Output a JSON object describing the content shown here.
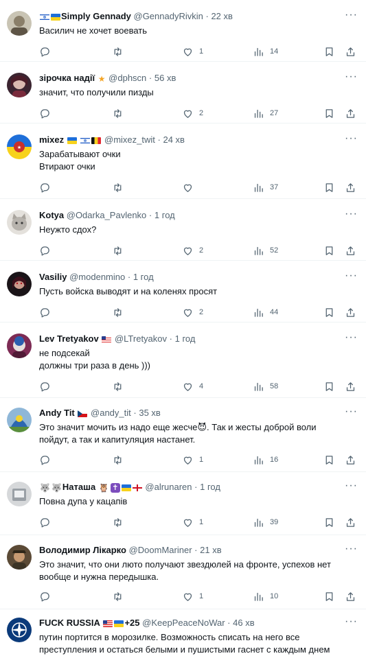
{
  "posts": [
    {
      "prefix": "",
      "name": "Simply Gennady",
      "handle": "@GennadyRivkin",
      "time": "22 хв",
      "lines": [
        "Василич не хочет воевать"
      ],
      "reply": "",
      "retweet": "",
      "like": "1",
      "views": "14"
    },
    {
      "prefix": "",
      "name": "зірочка надії",
      "handle": "@dphscn",
      "time": "56 хв",
      "lines": [
        "значит, что получили пизды"
      ],
      "reply": "",
      "retweet": "",
      "like": "2",
      "views": "27"
    },
    {
      "prefix": "",
      "name": "mixez",
      "handle": "@mixez_twit",
      "time": "24 хв",
      "lines": [
        "Зарабатывают очки",
        "Втирают очки"
      ],
      "reply": "",
      "retweet": "",
      "like": "",
      "views": "37"
    },
    {
      "prefix": "",
      "name": "Kotya",
      "handle": "@Odarka_Pavlenko",
      "time": "1 год",
      "lines": [
        "Неужто сдох?"
      ],
      "reply": "",
      "retweet": "",
      "like": "2",
      "views": "52"
    },
    {
      "prefix": "",
      "name": "Vasiliy",
      "handle": "@modenmino",
      "time": "1 год",
      "lines": [
        "Пусть войска выводят и на коленях просят"
      ],
      "reply": "",
      "retweet": "",
      "like": "2",
      "views": "44"
    },
    {
      "prefix": "",
      "name": "Lev Tretyakov",
      "handle": "@LTretyakov",
      "time": "1 год",
      "lines": [
        "не подсекай",
        "должны три раза в день )))"
      ],
      "reply": "",
      "retweet": "",
      "like": "4",
      "views": "58"
    },
    {
      "prefix": "",
      "name": "Andy Tit",
      "handle": "@andy_tit",
      "time": "35 хв",
      "lines": [
        "Это значит мочить из надо еще жесче😈. Так и жесты доброй воли",
        "пойдут, а так и капитуляция настанет."
      ],
      "reply": "",
      "retweet": "",
      "like": "1",
      "views": "16"
    },
    {
      "prefix": "",
      "name": "Наташа",
      "handle": "@alrunaren",
      "time": "1 год",
      "lines": [
        "Повна дупа у кацапів"
      ],
      "reply": "",
      "retweet": "",
      "like": "1",
      "views": "39"
    },
    {
      "prefix": "",
      "name": "Володимир Лікарко",
      "handle": "@DoomMariner",
      "time": "21 хв",
      "lines": [
        "Это значит, что они люто получают звездюлей на фронте, успехов нет",
        "вообще и нужна передышка."
      ],
      "reply": "",
      "retweet": "",
      "like": "1",
      "views": "10"
    },
    {
      "prefix": "",
      "name": "FUCK RUSSIA",
      "handle": "@KeepPeaceNoWar",
      "time": "46 хв",
      "lines": [
        "путин портится в морозилке.  Возможность списать на него все",
        "преступления и остаться белыми и пушистыми гаснет с каждым днем"
      ],
      "reply": "",
      "retweet": "",
      "like": "",
      "views": ""
    }
  ],
  "badges": {
    "p3_extra": "🇺🇦 🇮🇱🇧🇪",
    "p9_plus": "+25",
    "p7_flag": "🇨🇿",
    "p8_owls": "🦉🦉",
    "p8_end": "🦉"
  },
  "colors": {
    "text": "#0f1419",
    "muted": "#536471",
    "divider": "#eff3f4"
  },
  "icons": [
    "reply-icon",
    "retweet-icon",
    "like-icon",
    "views-icon",
    "bookmark-icon",
    "share-icon",
    "more-icon"
  ]
}
